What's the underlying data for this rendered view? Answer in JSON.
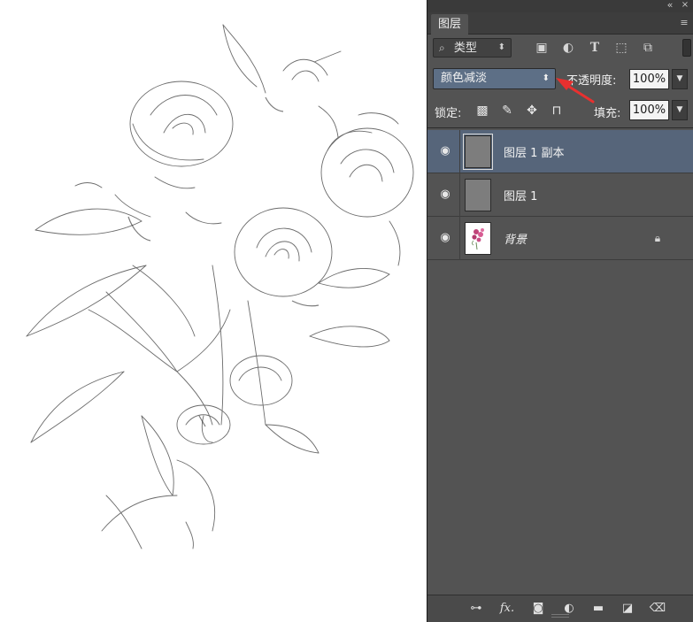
{
  "panel": {
    "tab_label": "图层",
    "filter": {
      "icon": "search-icon",
      "label": "类型"
    },
    "blend_mode": "颜色减淡",
    "opacity_label": "不透明度:",
    "opacity_value": "100%",
    "lock_label": "锁定:",
    "fill_label": "填充:",
    "fill_value": "100%",
    "layers": [
      {
        "name": "图层 1 副本",
        "selected": true,
        "visible": true,
        "locked": false
      },
      {
        "name": "图层 1",
        "selected": false,
        "visible": true,
        "locked": false
      },
      {
        "name": "背景",
        "selected": false,
        "visible": true,
        "locked": true
      }
    ]
  },
  "icons": {
    "filter_types": [
      "image-filter-icon",
      "adjustment-filter-icon",
      "type-filter-icon",
      "shape-filter-icon",
      "smart-object-filter-icon"
    ],
    "lock_types": [
      "lock-transparent-pixels-icon",
      "lock-image-pixels-icon",
      "lock-position-icon",
      "lock-all-icon"
    ],
    "footer": [
      "link-layers-icon",
      "fx-icon",
      "layer-mask-icon",
      "adjustment-layer-icon",
      "group-folder-icon",
      "new-layer-icon",
      "trash-icon"
    ]
  },
  "colors": {
    "panel_bg": "#535353",
    "selected_row": "#56657a",
    "blend_select_bg": "#5d6f86",
    "annotation_arrow": "#e8302f"
  }
}
